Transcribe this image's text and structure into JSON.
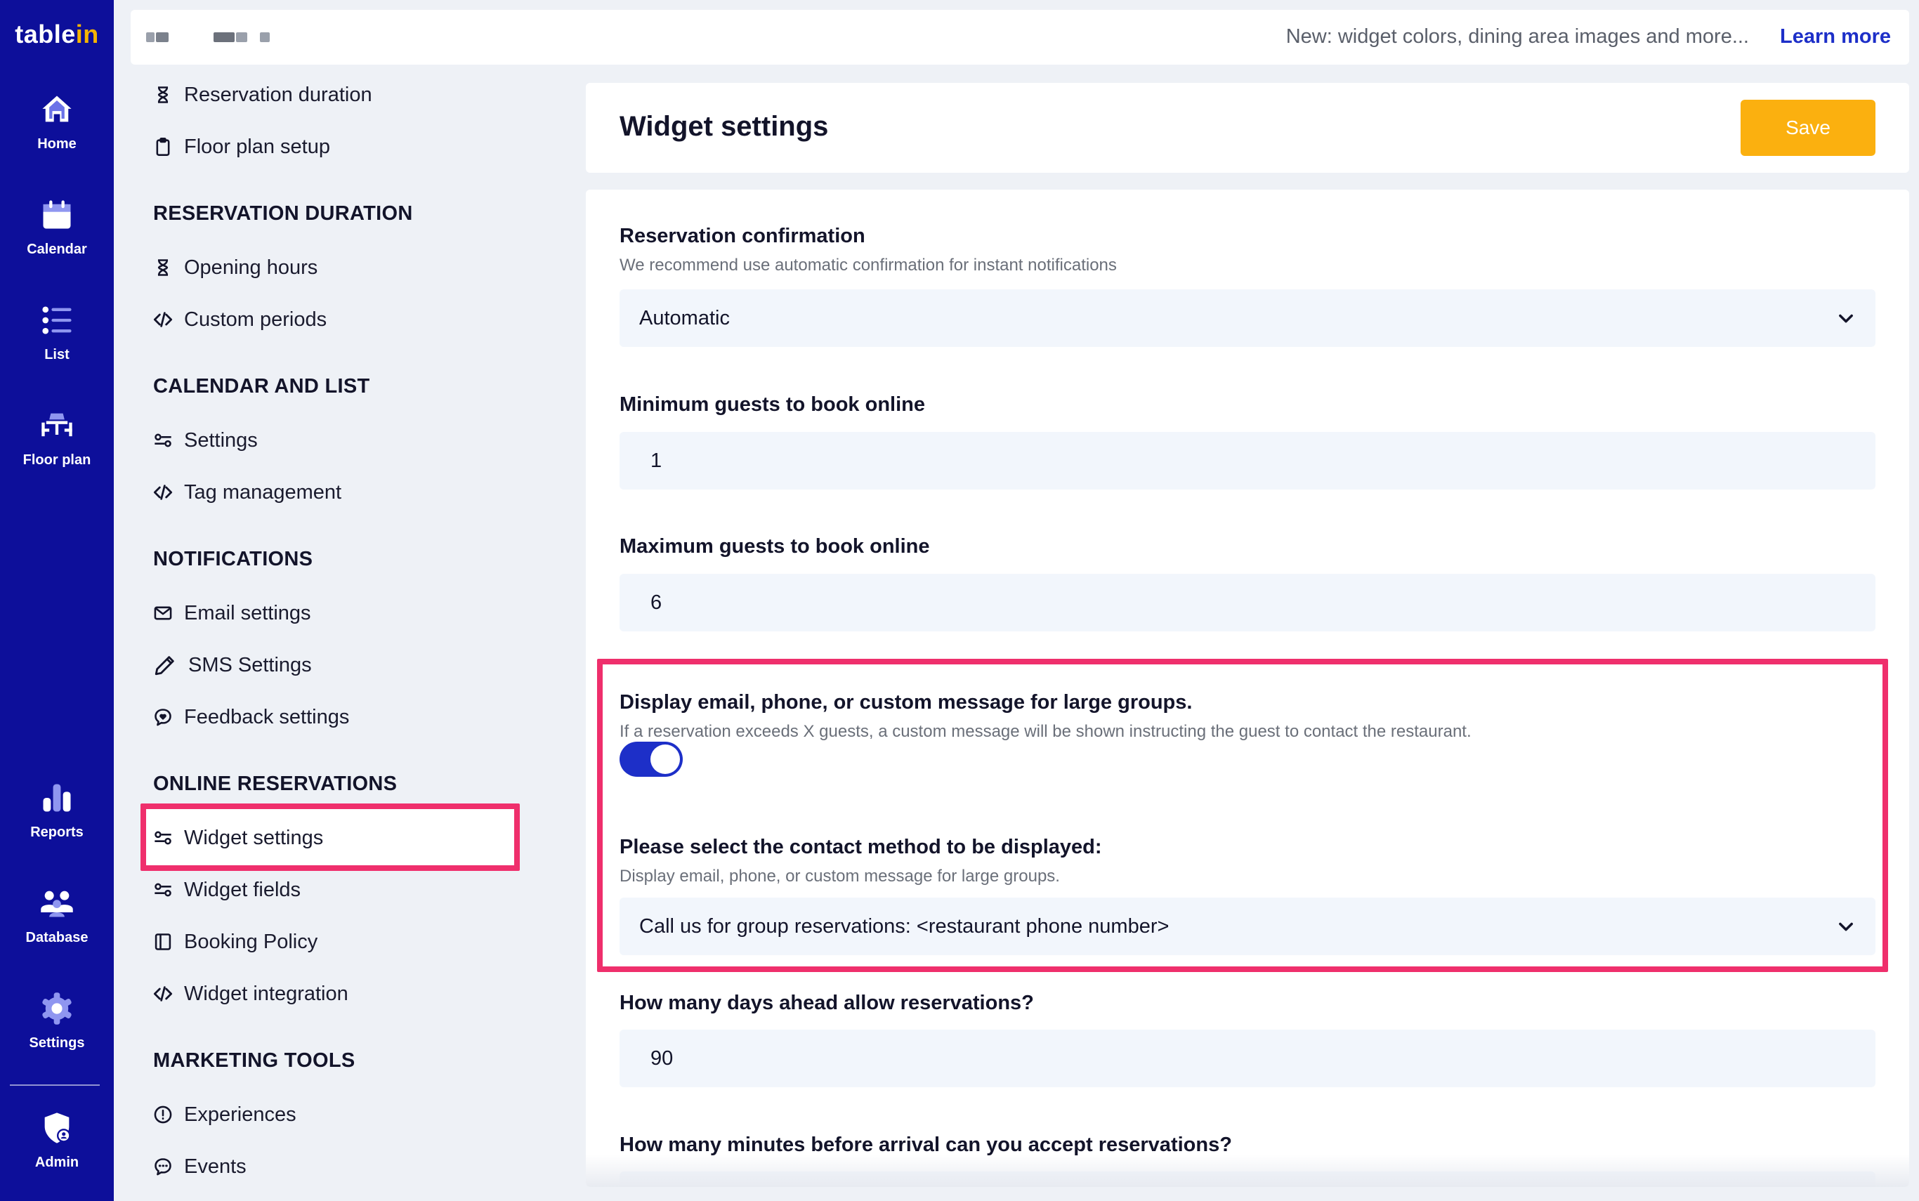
{
  "app": {
    "logo_main": "table",
    "logo_accent": "in"
  },
  "nav": {
    "items": [
      {
        "label": "Home",
        "icon": "home-icon"
      },
      {
        "label": "Calendar",
        "icon": "calendar-icon"
      },
      {
        "label": "List",
        "icon": "list-icon"
      },
      {
        "label": "Floor plan",
        "icon": "floor-plan-icon"
      },
      {
        "label": "Reports",
        "icon": "bar-chart-icon"
      },
      {
        "label": "Database",
        "icon": "users-icon"
      },
      {
        "label": "Settings",
        "icon": "gear-icon"
      },
      {
        "label": "Admin",
        "icon": "shield-user-icon"
      }
    ]
  },
  "banner": {
    "text": "New: widget colors, dining area images and more...",
    "link": "Learn more"
  },
  "submenu": {
    "top_items": [
      {
        "label": "Reservation duration",
        "icon": "hourglass-icon"
      },
      {
        "label": "Floor plan setup",
        "icon": "clipboard-icon"
      }
    ],
    "sections": [
      {
        "title": "RESERVATION DURATION",
        "items": [
          {
            "label": "Opening hours",
            "icon": "hourglass-icon"
          },
          {
            "label": "Custom periods",
            "icon": "code-icon"
          }
        ]
      },
      {
        "title": "CALENDAR AND LIST",
        "items": [
          {
            "label": "Settings",
            "icon": "sliders-icon"
          },
          {
            "label": "Tag management",
            "icon": "code-icon"
          }
        ]
      },
      {
        "title": "NOTIFICATIONS",
        "items": [
          {
            "label": "Email settings",
            "icon": "mail-icon"
          },
          {
            "label": "SMS Settings",
            "icon": "pencil-icon"
          },
          {
            "label": "Feedback settings",
            "icon": "chat-heart-icon"
          }
        ]
      },
      {
        "title": "ONLINE RESERVATIONS",
        "items": [
          {
            "label": "Widget settings",
            "icon": "sliders-icon",
            "active": true
          },
          {
            "label": "Widget fields",
            "icon": "sliders-icon"
          },
          {
            "label": "Booking Policy",
            "icon": "book-icon"
          },
          {
            "label": "Widget integration",
            "icon": "code-icon"
          }
        ]
      },
      {
        "title": "MARKETING TOOLS",
        "items": [
          {
            "label": "Experiences",
            "icon": "alert-circle-icon"
          },
          {
            "label": "Events",
            "icon": "chat-bubble-icon"
          }
        ]
      }
    ]
  },
  "page": {
    "title": "Widget settings",
    "save_label": "Save"
  },
  "form": {
    "confirmation": {
      "label": "Reservation confirmation",
      "hint": "We recommend use automatic confirmation for instant notifications",
      "value": "Automatic"
    },
    "min_guests": {
      "label": "Minimum guests to book online",
      "value": "1"
    },
    "max_guests": {
      "label": "Maximum guests to book online",
      "value": "6"
    },
    "large_groups": {
      "label": "Display email, phone, or custom message for large groups.",
      "hint": "If a reservation exceeds X guests, a custom message will be shown instructing the guest to contact the restaurant.",
      "enabled": true
    },
    "contact_method": {
      "label": "Please select the contact method to be displayed:",
      "hint": "Display email, phone, or custom message for large groups.",
      "value": "Call us for group reservations: <restaurant phone number>"
    },
    "days_ahead": {
      "label": "How many days ahead allow reservations?",
      "value": "90"
    },
    "minutes_before": {
      "label": "How many minutes before arrival can you accept reservations?"
    }
  },
  "colors": {
    "rail": "#0d0f9a",
    "accent": "#1d2fc8",
    "save": "#fbb00f",
    "highlight": "#ef2f6c",
    "logo_accent": "#f5b400"
  }
}
